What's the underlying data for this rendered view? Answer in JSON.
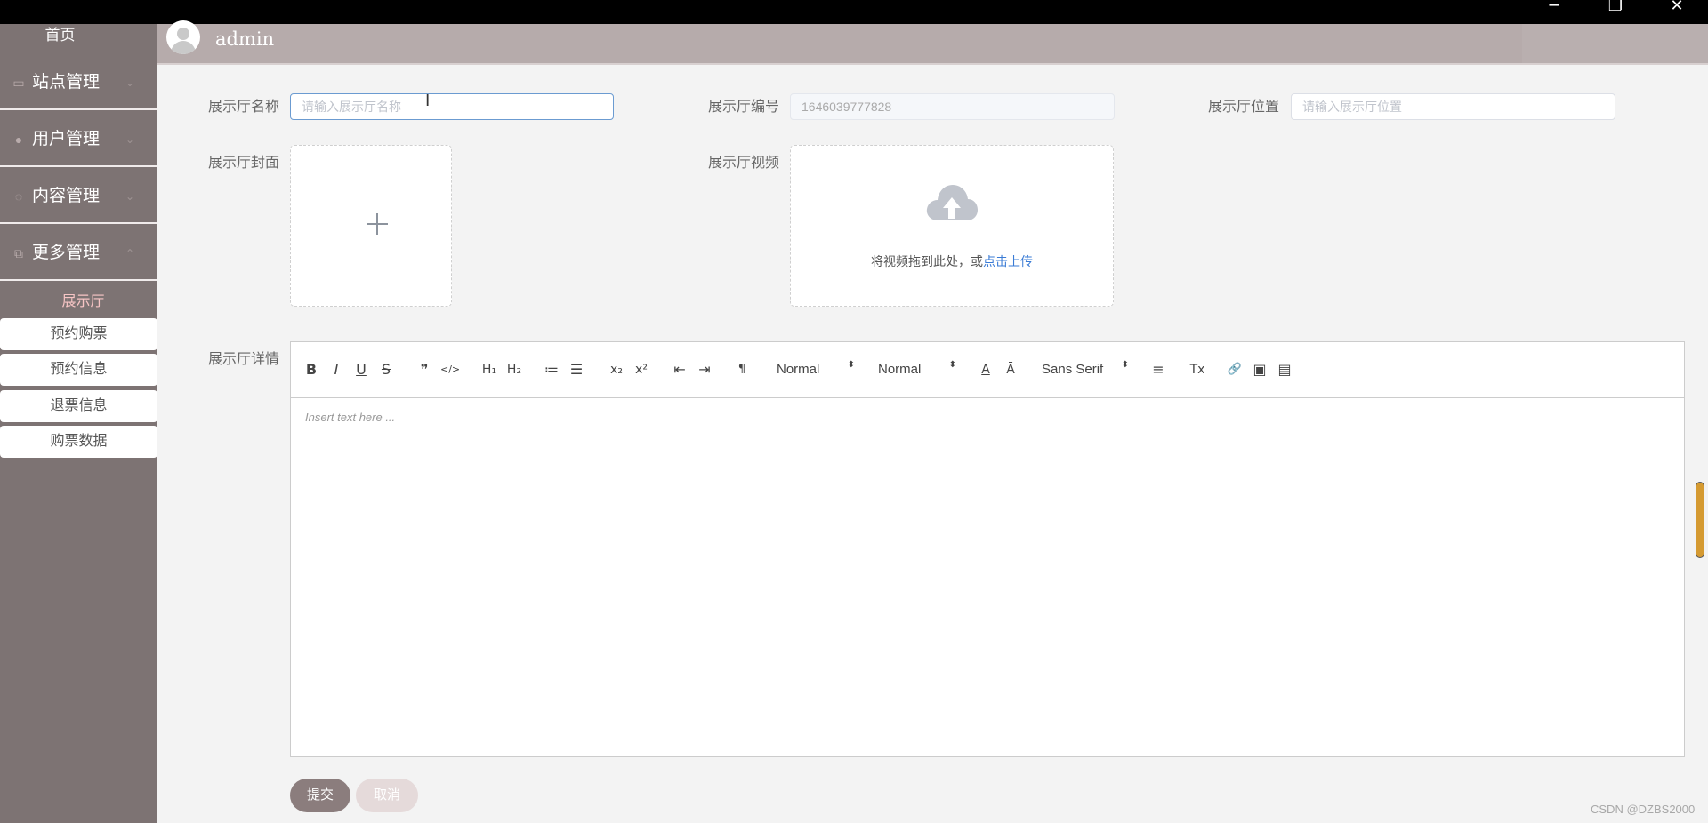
{
  "window": {
    "minimize": "─",
    "restore": "❐",
    "close": "✕"
  },
  "sidebar": {
    "home": "首页",
    "items": [
      {
        "label": "站点管理",
        "icon": "monitor-icon",
        "glyph": "▭",
        "chevron": "⌄"
      },
      {
        "label": "用户管理",
        "icon": "user-icon",
        "glyph": "●",
        "chevron": "⌄"
      },
      {
        "label": "内容管理",
        "icon": "chat-icon",
        "glyph": "◌",
        "chevron": "⌄"
      },
      {
        "label": "更多管理",
        "icon": "copy-icon",
        "glyph": "⧉",
        "chevron": "⌃"
      }
    ],
    "active_sub": "展示厅",
    "sub_items": [
      "预约购票",
      "预约信息",
      "退票信息",
      "购票数据"
    ]
  },
  "header": {
    "username": "admin"
  },
  "form": {
    "name_label": "展示厅名称",
    "name_placeholder": "请输入展示厅名称",
    "number_label": "展示厅编号",
    "number_value": "1646039777828",
    "location_label": "展示厅位置",
    "location_placeholder": "请输入展示厅位置",
    "cover_label": "展示厅封面",
    "video_label": "展示厅视频",
    "video_hint": "将视频拖到此处，或",
    "video_link": "点击上传",
    "detail_label": "展示厅详情"
  },
  "editor": {
    "placeholder": "Insert text here ...",
    "buttons": [
      "B",
      "I",
      "U",
      "S",
      "❞",
      "</>",
      "H₁",
      "H₂",
      "≔",
      "☰",
      "x₂",
      "x²",
      "⇤",
      "⇥",
      "¶",
      "A",
      "Ā",
      "≡",
      "Tx",
      "🔗",
      "▣",
      "▤"
    ],
    "select_size": "Normal",
    "select_header": "Normal",
    "select_font": "Sans Serif",
    "arrows": "⬍"
  },
  "actions": {
    "submit": "提交",
    "cancel": "取消"
  },
  "watermark": "CSDN @DZBS2000"
}
